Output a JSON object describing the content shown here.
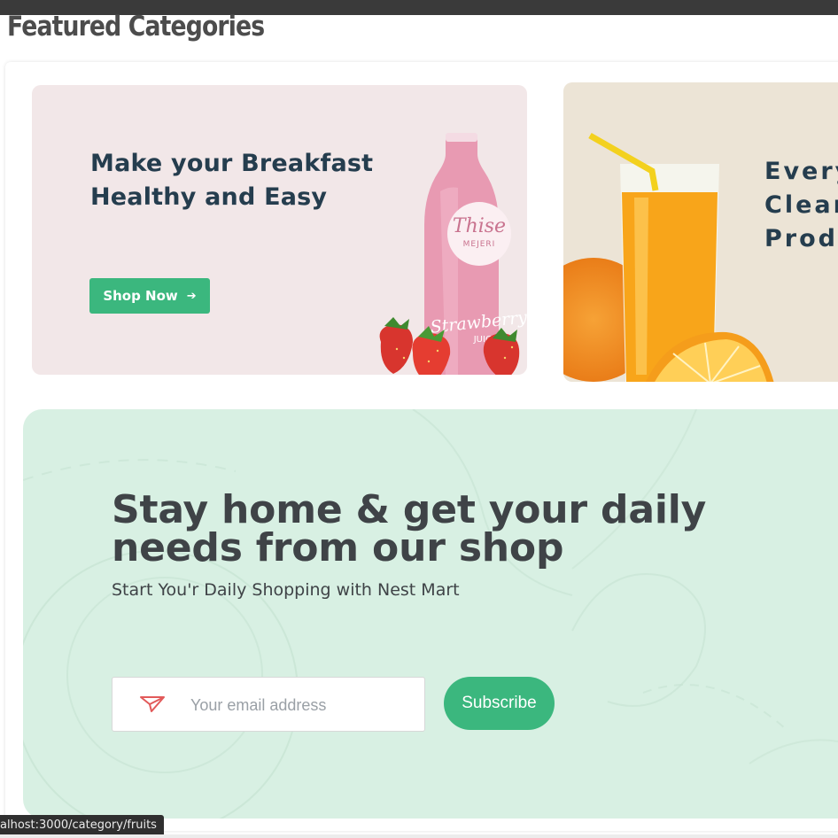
{
  "page": {
    "heading": "Featured Categories"
  },
  "banners": [
    {
      "title": "Make your Breakfast\nHealthy and Easy",
      "button_label": "Shop Now",
      "button_icon": "arrow-right-icon",
      "image": "strawberry-juice-bottle",
      "bottle_label": "Thise",
      "bottle_sublabel": "MEJERI",
      "bottle_text": "Strawberry",
      "bottle_subtext": "JUICE",
      "background": "#f2e7e8"
    },
    {
      "title": "Every\nClear\nProdu",
      "image": "orange-juice-glass",
      "background": "#ece4d6"
    }
  ],
  "newsletter": {
    "heading": "Stay home & get your daily\nneeds from our shop",
    "subheading": "Start You'r Daily Shopping with Nest Mart",
    "email_placeholder": "Your email address",
    "email_icon": "send-icon",
    "subscribe_label": "Subscribe",
    "background": "#d8f0e3"
  },
  "statusbar": {
    "url": "alhost:3000/category/fruits"
  },
  "colors": {
    "brand": "#3bb77e",
    "heading": "#253d4e",
    "text": "#3f4347"
  }
}
